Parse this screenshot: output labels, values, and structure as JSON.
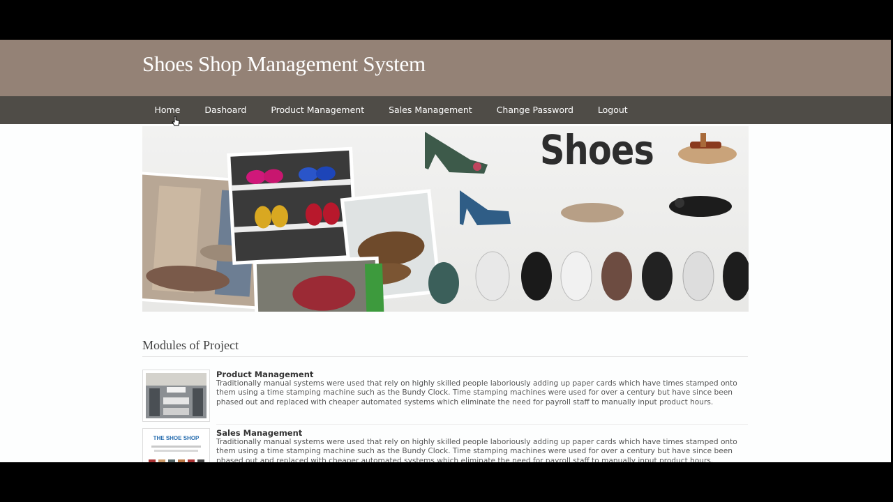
{
  "header": {
    "title": "Shoes Shop Management System"
  },
  "nav": {
    "items": [
      {
        "label": "Home"
      },
      {
        "label": "Dashoard"
      },
      {
        "label": "Product Management"
      },
      {
        "label": "Sales Management"
      },
      {
        "label": "Change Password"
      },
      {
        "label": "Logout"
      }
    ]
  },
  "banner": {
    "heading": "Shoes"
  },
  "modules_section": {
    "title": "Modules of Project",
    "modules": [
      {
        "title": "Product Management",
        "description": "Traditionally manual systems were used that rely on highly skilled people laboriously adding up paper cards which have times stamped onto them using a time stamping machine such as the Bundy Clock. Time stamping machines were used for over a century but have since been phased out and replaced with cheaper automated systems which eliminate the need for payroll staff to manually input product hours."
      },
      {
        "title": "Sales Management",
        "description": "Traditionally manual systems were used that rely on highly skilled people laboriously adding up paper cards which have times stamped onto them using a time stamping machine such as the Bundy Clock. Time stamping machines were used for over a century but have since been phased out and replaced with cheaper automated systems which eliminate the need for payroll staff to manually input product hours.",
        "thumb_text": "THE SHOE SHOP"
      }
    ]
  },
  "colors": {
    "header_bg": "#948276",
    "nav_bg": "#4f4c47",
    "page_bg": "#fdfefe"
  }
}
